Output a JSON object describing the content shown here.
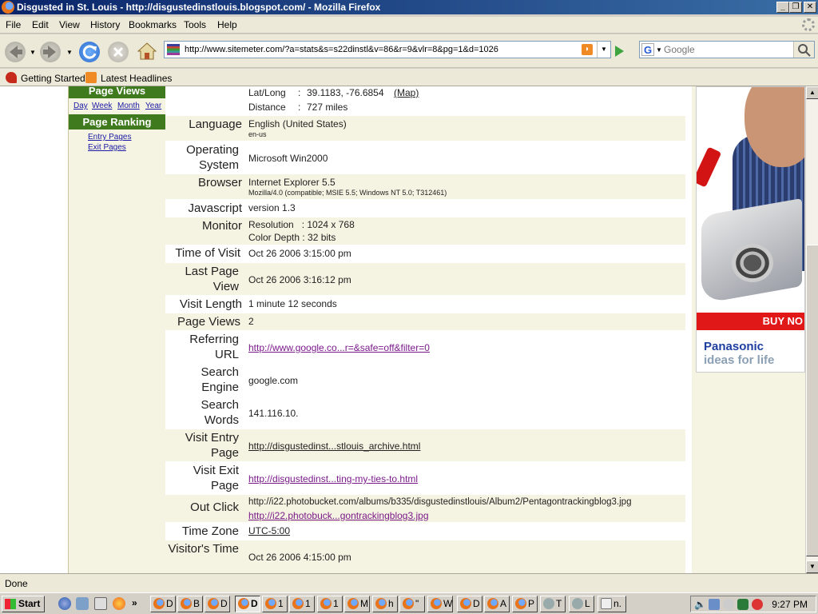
{
  "window": {
    "title": "Disgusted in St. Louis - http://disgustedinstlouis.blogspot.com/ - Mozilla Firefox"
  },
  "menu": [
    "File",
    "Edit",
    "View",
    "History",
    "Bookmarks",
    "Tools",
    "Help"
  ],
  "nav": {
    "url": "http://www.sitemeter.com/?a=stats&s=s22dinstl&v=86&r=9&vlr=8&pg=1&d=1026",
    "search_placeholder": "Google"
  },
  "bookmarks": [
    "Getting Started",
    "Latest Headlines"
  ],
  "sidebar": {
    "page_views_head": "Page Views",
    "page_views_links": [
      "Day",
      "Week",
      "Month",
      "Year"
    ],
    "page_ranking_head": "Page Ranking",
    "page_ranking_links": [
      "Entry Pages",
      "Exit Pages"
    ]
  },
  "details": {
    "latlong_label": "Lat/Long",
    "latlong_value": "39.1183, -76.6854",
    "map_link": "(Map)",
    "distance_label": "Distance",
    "distance_value": "727 miles",
    "colon": ":",
    "rows": [
      {
        "label": "Language",
        "value": "English (United States)",
        "sub": "en-us"
      },
      {
        "label": "Operating System",
        "value": "Microsoft Win2000"
      },
      {
        "label": "Browser",
        "value": "Internet Explorer 5.5",
        "sub": "Mozilla/4.0 (compatible; MSIE 5.5; Windows NT 5.0; T312461)"
      },
      {
        "label": "Javascript",
        "value": "version 1.3"
      },
      {
        "label": "Monitor",
        "value": "Resolution   : 1024 x 768",
        "value2": "Color Depth : 32 bits"
      },
      {
        "label": "Time of Visit",
        "value": "Oct 26 2006 3:15:00 pm"
      },
      {
        "label": "Last Page View",
        "value": "Oct 26 2006 3:16:12 pm"
      },
      {
        "label": "Visit Length",
        "value": "1 minute 12 seconds"
      },
      {
        "label": "Page Views",
        "value": "2"
      },
      {
        "label": "Referring URL",
        "value": "http://www.google.co...r=&safe=off&filter=0"
      },
      {
        "label": "Search Engine",
        "value": "google.com"
      },
      {
        "label": "Search Words",
        "value": "141.116.10."
      },
      {
        "label": "Visit Entry Page",
        "value": "http://disgustedinst...stlouis_archive.html"
      },
      {
        "label": "Visit Exit Page",
        "value": "http://disgustedinst...ting-my-ties-to.html"
      },
      {
        "label": "Out Click",
        "value": "http://i22.photobucket.com/albums/b335/disgustedinstlouis/Album2/Pentagontrackingblog3.jpg",
        "value2": "http://i22.photobuck...gontrackingblog3.jpg"
      },
      {
        "label": "Time Zone",
        "value": "UTC-5:00"
      },
      {
        "label": "Visitor's Time",
        "value": "Oct 26 2006 4:15:00 pm"
      }
    ]
  },
  "ad": {
    "buy": "BUY NO",
    "brand": "Panasonic",
    "tagline": "ideas for life"
  },
  "status": "Done",
  "taskbar": {
    "start": "Start",
    "tasks": [
      "D",
      "B",
      "D",
      "D",
      "1",
      "1",
      "1",
      "M",
      "h",
      "\"",
      "W",
      "D",
      "A",
      "P",
      "T",
      "L",
      "n."
    ],
    "clock": "9:27 PM"
  }
}
